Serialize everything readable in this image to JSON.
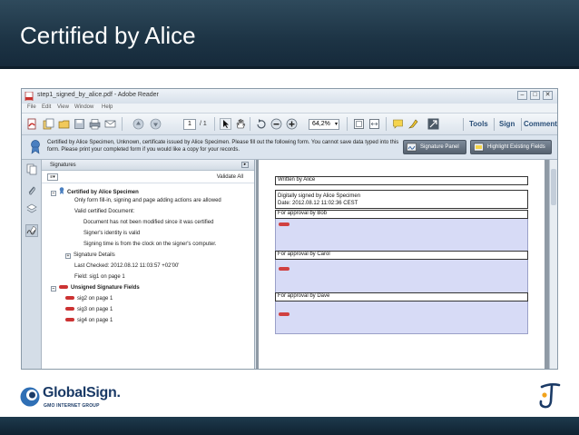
{
  "slide": {
    "title": "Certified by Alice"
  },
  "window": {
    "title": "step1_signed_by_alice.pdf - Adobe Reader",
    "controls": [
      "–",
      "□",
      "✕"
    ]
  },
  "menu": [
    "File",
    "Edit",
    "View",
    "Window",
    "Help"
  ],
  "toolbar": {
    "page_current": "1",
    "page_total": "/ 1",
    "zoom": "64,2%",
    "zoom_arrow": "▾",
    "links": [
      "Tools",
      "Sign",
      "Comment"
    ]
  },
  "signature_bar": {
    "message": "Certified by Alice Specimen, Unknown, certificate issued by Alice Specimen.  Please fill out the following form. You cannot save data typed into this form. Please print your completed form if you would like a copy for your records.",
    "signature_panel_button": "Signature Panel",
    "highlight_button": "Highlight Existing Fields"
  },
  "signatures_panel": {
    "title": "Signatures",
    "close": "▸",
    "options": "≡▾",
    "validate_all": "Validate All",
    "expand_minus": "−",
    "expand_plus": "+",
    "tree": {
      "certified": "Certified by Alice Specimen",
      "line1": "Only form fill-in, signing and page adding actions are allowed",
      "line2": "Valid certified Document:",
      "line3": "Document has not been modified since it was certified",
      "line4": "Signer's identity is valid",
      "line5": "Signing time is from the clock on the signer's computer.",
      "details": "Signature Details",
      "last_checked": "Last Checked: 2012.08.12 11:03:57 +02'00'",
      "field": "Field: sig1 on page 1",
      "unsigned": "Unsigned Signature Fields",
      "sig2": "sig2 on page 1",
      "sig3": "sig3 on page 1",
      "sig4": "sig4 on page 1"
    }
  },
  "document": {
    "written_by": "Written by Alice",
    "signed_line1": "Digitally signed by Alice Specimen",
    "signed_line2": "Date: 2012.08.12 11:02:36 CEST",
    "approval_bob": "For approval by Bob",
    "approval_carol": "For approval by Carol",
    "approval_dave": "For approval by Dave"
  },
  "footer": {
    "brand": "GlobalSign.",
    "brand_sub": "GMO INTERNET GROUP"
  },
  "colors": {
    "title_bar": "#1c3344",
    "signature_field": "#d7dbf6",
    "accent_link": "#2a4f78",
    "unsigned_marker": "#cc3333"
  }
}
